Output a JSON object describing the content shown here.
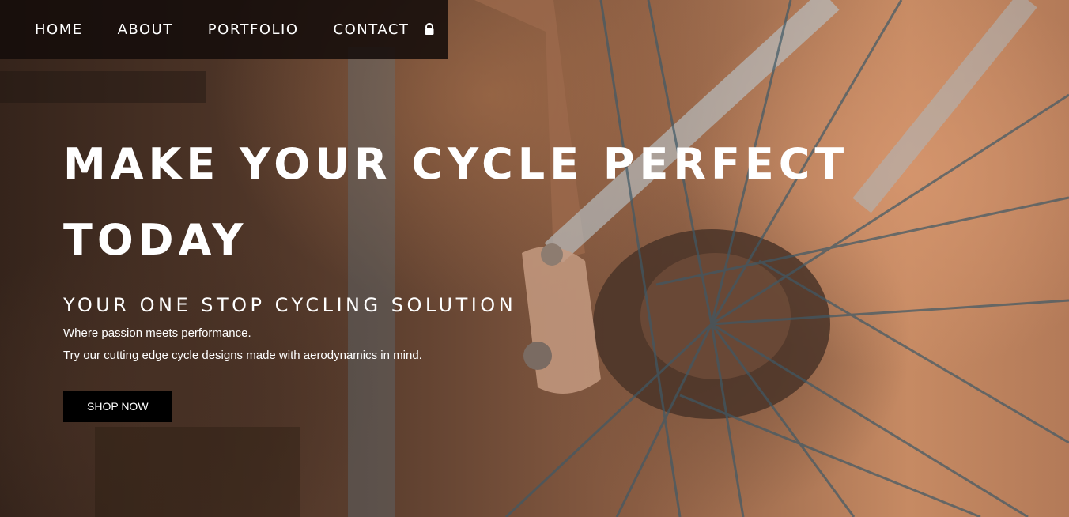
{
  "nav": {
    "items": [
      {
        "label": "HOME"
      },
      {
        "label": "ABOUT"
      },
      {
        "label": "PORTFOLIO"
      },
      {
        "label": "CONTACT"
      }
    ],
    "lock_icon": "lock-icon"
  },
  "hero": {
    "title_line1": "MAKE YOUR CYCLE PERFECT",
    "title_line2": "TODAY",
    "subtitle": "YOUR ONE STOP CYCLING SOLUTION",
    "text1": "Where passion meets performance.",
    "text2": "Try our cutting edge cycle designs made with aerodynamics in mind.",
    "cta": "SHOP NOW"
  }
}
